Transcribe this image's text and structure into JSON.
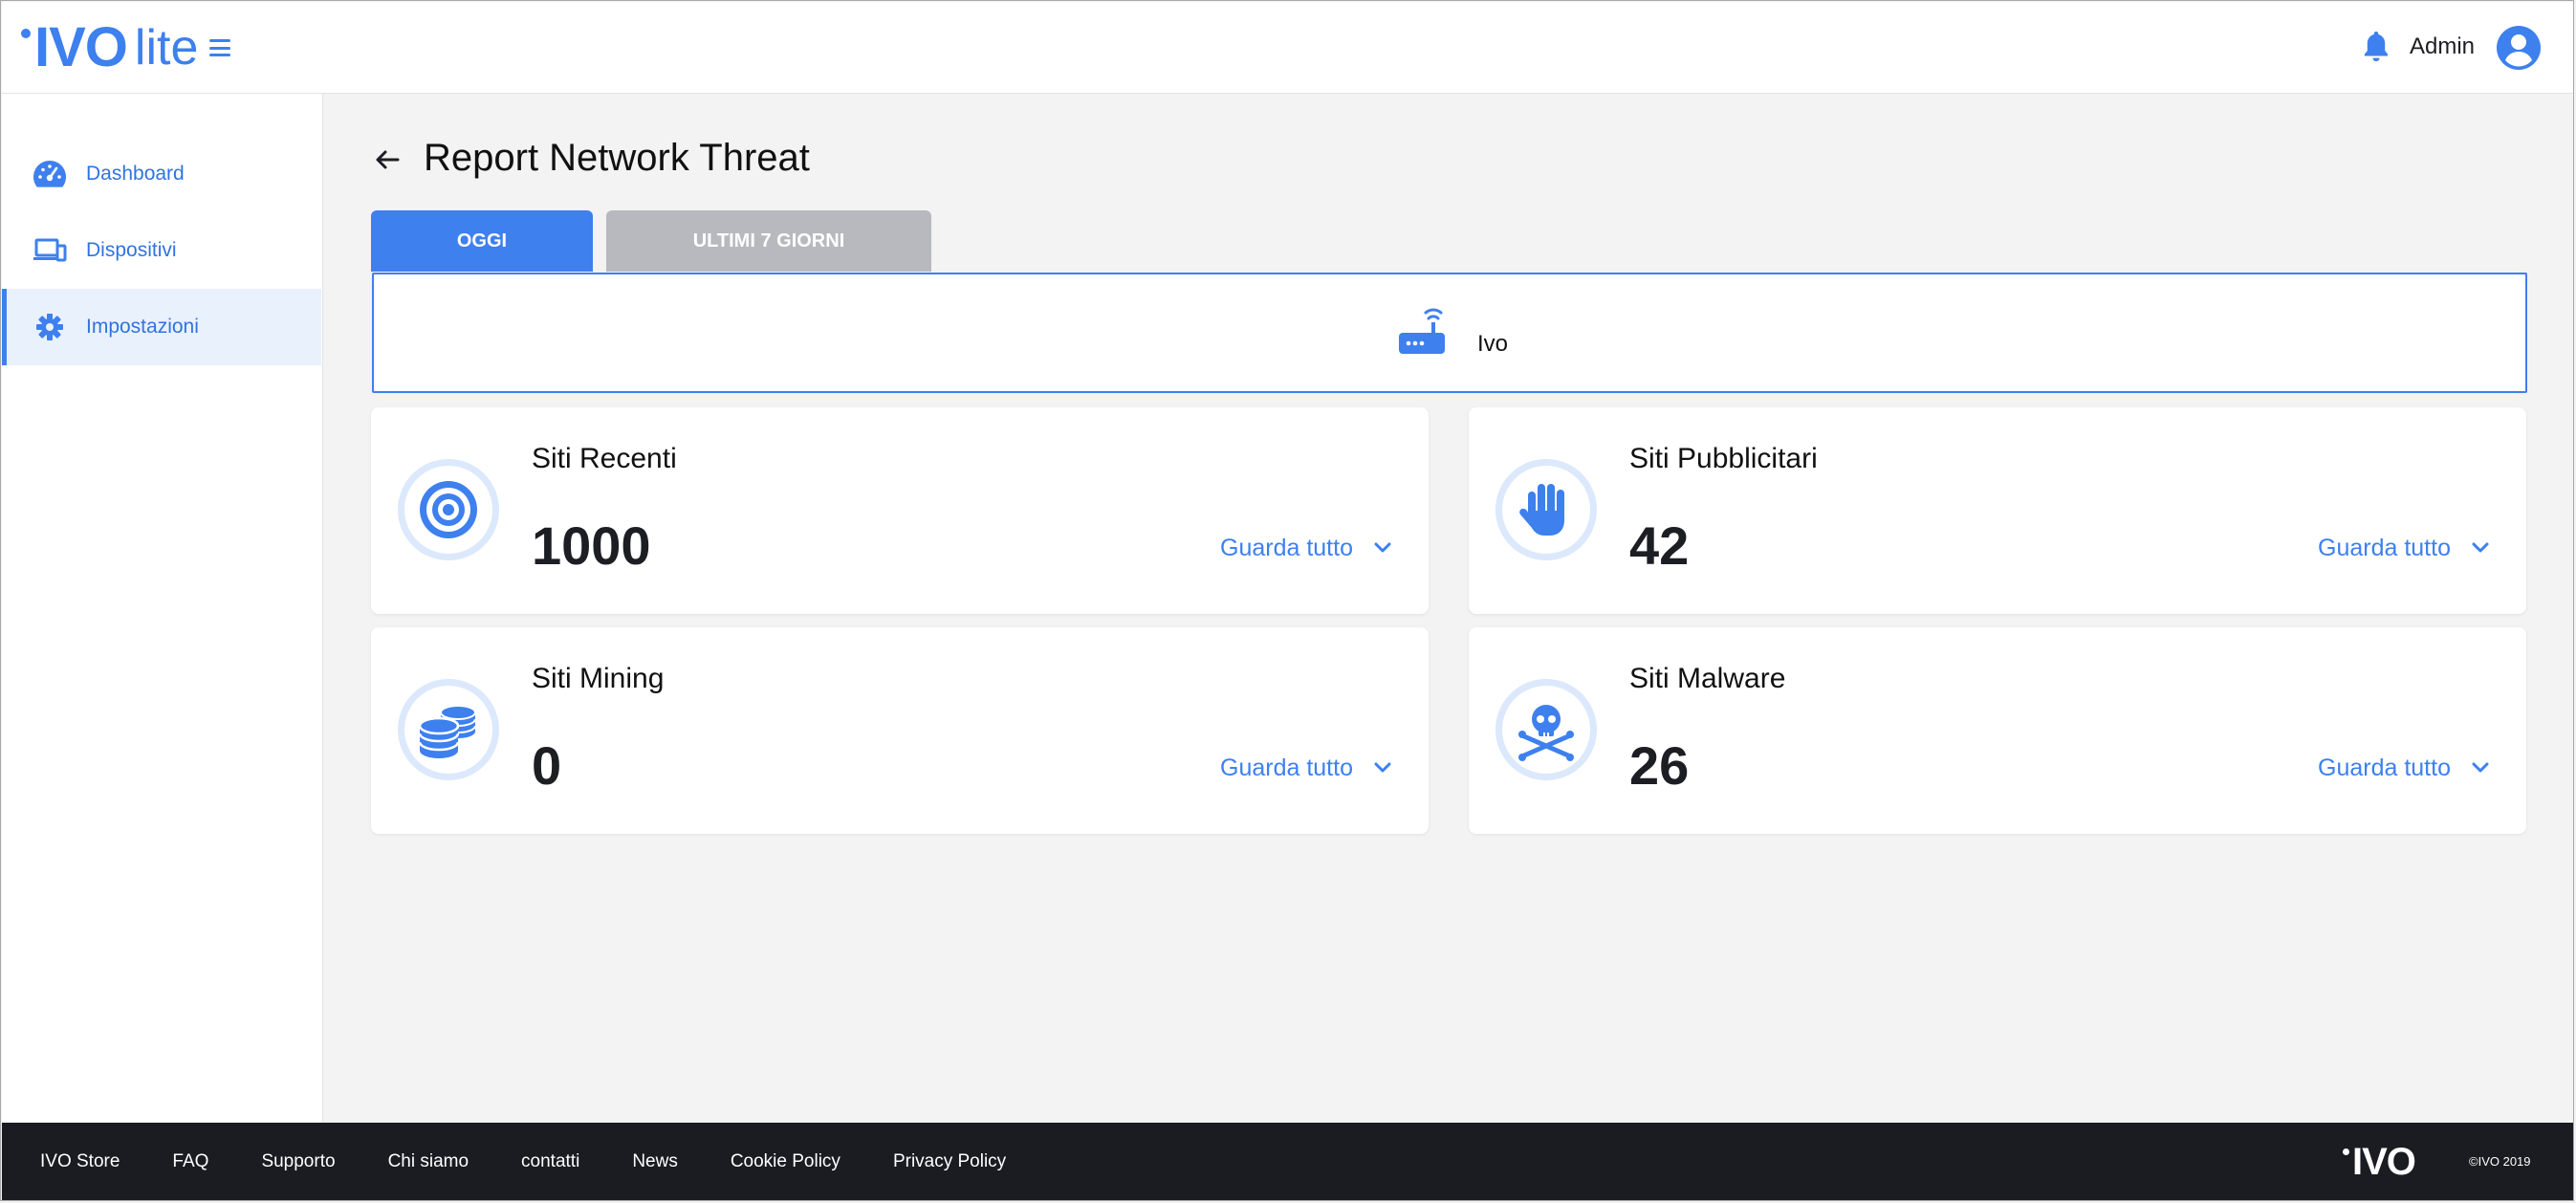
{
  "app": {
    "logo_main": "IVO",
    "logo_suffix": "lite"
  },
  "header": {
    "user_label": "Admin"
  },
  "sidebar": {
    "items": [
      {
        "label": "Dashboard",
        "icon": "dashboard-gauge-icon",
        "active": false
      },
      {
        "label": "Dispositivi",
        "icon": "devices-icon",
        "active": false
      },
      {
        "label": "Impostazioni",
        "icon": "gear-icon",
        "active": true
      }
    ]
  },
  "main": {
    "title": "Report Network Threat",
    "tabs": [
      {
        "label": "OGGI",
        "active": true
      },
      {
        "label": "ULTIMI 7 GIORNI",
        "active": false
      }
    ],
    "device": {
      "name": "Ivo",
      "icon": "router-icon"
    },
    "cards": [
      {
        "title": "Siti Recenti",
        "value": "1000",
        "link": "Guarda tutto",
        "icon": "target-icon"
      },
      {
        "title": "Siti Pubblicitari",
        "value": "42",
        "link": "Guarda tutto",
        "icon": "hand-stop-icon"
      },
      {
        "title": "Siti Mining",
        "value": "0",
        "link": "Guarda tutto",
        "icon": "coins-icon"
      },
      {
        "title": "Siti Malware",
        "value": "26",
        "link": "Guarda tutto",
        "icon": "skull-crossbones-icon"
      }
    ]
  },
  "footer": {
    "links": [
      "IVO Store",
      "FAQ",
      "Supporto",
      "Chi siamo",
      "contatti",
      "News",
      "Cookie Policy",
      "Privacy Policy"
    ],
    "logo": "IVO",
    "copyright": "©IVO 2019"
  },
  "colors": {
    "accent": "#3d80ee",
    "tab_inactive": "#b8b9be",
    "footer_bg": "#1b1b22",
    "page_bg": "#f3f3f3"
  }
}
